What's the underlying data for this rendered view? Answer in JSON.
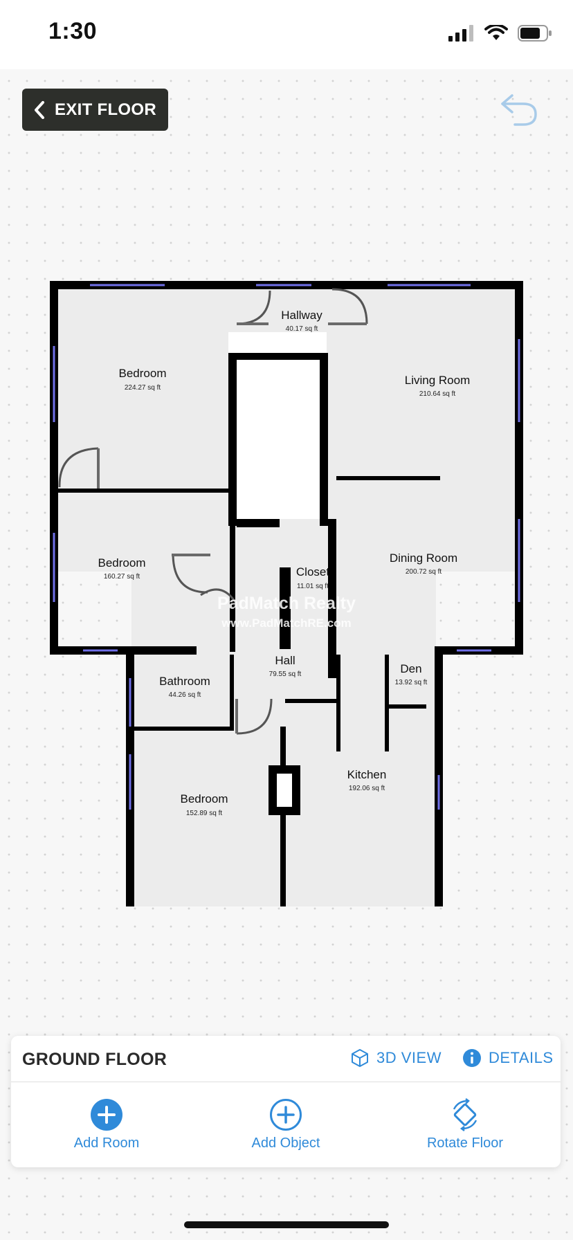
{
  "status_bar": {
    "time": "1:30",
    "icons": [
      "signal-icon",
      "wifi-icon",
      "battery-icon"
    ]
  },
  "toolbar": {
    "exit_label": "EXIT FLOOR",
    "undo_icon": "undo-icon"
  },
  "floor_plan": {
    "watermark": {
      "line1": "PadMatch Realty",
      "line2": "www.PadMatchRE.com"
    },
    "rooms": [
      {
        "name": "Hallway",
        "area": "40.17 sq ft"
      },
      {
        "name": "Bedroom",
        "area": "224.27 sq ft"
      },
      {
        "name": "Living Room",
        "area": "210.64 sq ft"
      },
      {
        "name": "Bedroom",
        "area": "160.27 sq ft"
      },
      {
        "name": "Closet",
        "area": "11.01 sq ft"
      },
      {
        "name": "Dining Room",
        "area": "200.72 sq ft"
      },
      {
        "name": "Hall",
        "area": "79.55 sq ft"
      },
      {
        "name": "Den",
        "area": "13.92 sq ft"
      },
      {
        "name": "Bathroom",
        "area": "44.26 sq ft"
      },
      {
        "name": "Kitchen",
        "area": "192.06 sq ft"
      },
      {
        "name": "Bedroom",
        "area": "152.89 sq ft"
      }
    ]
  },
  "panel": {
    "floor_name": "GROUND FLOOR",
    "view_3d_label": "3D VIEW",
    "details_label": "DETAILS",
    "actions": [
      {
        "label": "Add Room",
        "icon": "add-room-icon"
      },
      {
        "label": "Add Object",
        "icon": "add-object-icon"
      },
      {
        "label": "Rotate Floor",
        "icon": "rotate-floor-icon"
      }
    ]
  },
  "colors": {
    "accent": "#2f8ad9",
    "exit_button_bg": "#2d2f2b",
    "wall": "#000000",
    "room_fill": "#ececec",
    "window": "#6f6fe8"
  }
}
